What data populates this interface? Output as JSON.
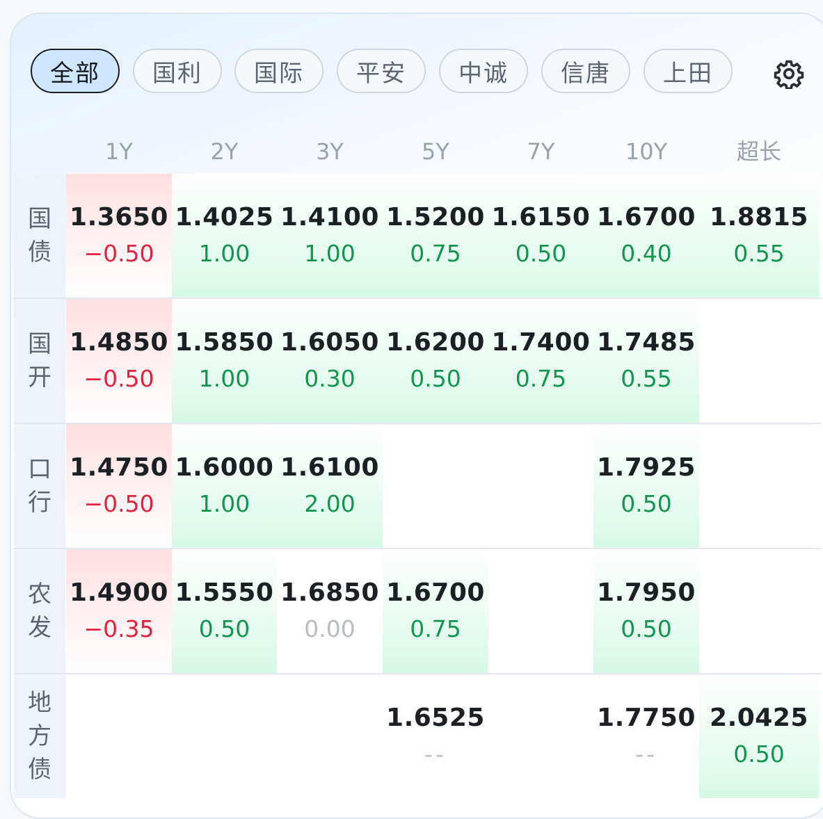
{
  "filters": [
    {
      "label": "全部",
      "active": true
    },
    {
      "label": "国利",
      "active": false
    },
    {
      "label": "国际",
      "active": false
    },
    {
      "label": "平安",
      "active": false
    },
    {
      "label": "中诚",
      "active": false
    },
    {
      "label": "信唐",
      "active": false
    },
    {
      "label": "上田",
      "active": false
    }
  ],
  "settings_icon": "gear-icon",
  "columns": [
    "1Y",
    "2Y",
    "3Y",
    "5Y",
    "7Y",
    "10Y",
    "超长"
  ],
  "rows": [
    {
      "label": "国债",
      "cells": [
        {
          "yield": "1.3650",
          "change": "-0.50"
        },
        {
          "yield": "1.4025",
          "change": "1.00"
        },
        {
          "yield": "1.4100",
          "change": "1.00"
        },
        {
          "yield": "1.5200",
          "change": "0.75"
        },
        {
          "yield": "1.6150",
          "change": "0.50"
        },
        {
          "yield": "1.6700",
          "change": "0.40"
        },
        {
          "yield": "1.8815",
          "change": "0.55"
        }
      ]
    },
    {
      "label": "国开",
      "cells": [
        {
          "yield": "1.4850",
          "change": "-0.50"
        },
        {
          "yield": "1.5850",
          "change": "1.00"
        },
        {
          "yield": "1.6050",
          "change": "0.30"
        },
        {
          "yield": "1.6200",
          "change": "0.50"
        },
        {
          "yield": "1.7400",
          "change": "0.75"
        },
        {
          "yield": "1.7485",
          "change": "0.55"
        },
        null
      ]
    },
    {
      "label": "口行",
      "cells": [
        {
          "yield": "1.4750",
          "change": "-0.50"
        },
        {
          "yield": "1.6000",
          "change": "1.00"
        },
        {
          "yield": "1.6100",
          "change": "2.00"
        },
        null,
        null,
        {
          "yield": "1.7925",
          "change": "0.50"
        },
        null
      ]
    },
    {
      "label": "农发",
      "cells": [
        {
          "yield": "1.4900",
          "change": "-0.35"
        },
        {
          "yield": "1.5550",
          "change": "0.50"
        },
        {
          "yield": "1.6850",
          "change": "0.00"
        },
        {
          "yield": "1.6700",
          "change": "0.75"
        },
        null,
        {
          "yield": "1.7950",
          "change": "0.50"
        },
        null
      ]
    },
    {
      "label": "地方债",
      "cells": [
        null,
        null,
        null,
        {
          "yield": "1.6525",
          "change": "--"
        },
        null,
        {
          "yield": "1.7750",
          "change": "--"
        },
        {
          "yield": "2.0425",
          "change": "0.50"
        }
      ]
    }
  ],
  "colors": {
    "negative": "#e0223f",
    "positive": "#13954f",
    "neutral": "#b5bcc4",
    "active_filter_bg": "#cfe6ff"
  }
}
